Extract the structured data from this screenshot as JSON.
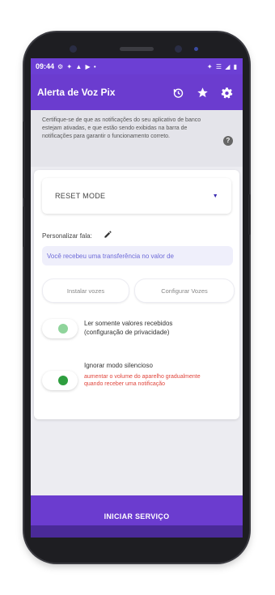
{
  "status_bar": {
    "time": "09:44",
    "left_icons": "⚙ ✦ ▲ ▶ •",
    "right_icons": "✦ ☰ ◢ ▮"
  },
  "app_bar": {
    "title": "Alerta de Voz Pix"
  },
  "notice": {
    "text": "Certifique-se de que as notificações do seu aplicativo de banco estejam ativadas, e que estão sendo exibidas na barra de notificações para garantir o funcionamento correto."
  },
  "mode_select": {
    "value": "RESET MODE"
  },
  "personalize": {
    "label": "Personalizar fala:"
  },
  "speech_input": {
    "value": "Você recebeu uma transferência no valor de"
  },
  "buttons": {
    "install_voices": "Instalar vozes",
    "configure_voices": "Configurar Vozes"
  },
  "toggles": [
    {
      "label": "Ler somente valores recebidos (configuração de privacidade)",
      "enabled": false
    },
    {
      "label": "Ignorar modo silencioso",
      "warning": "aumentar o volume do aparelho gradualmente quando receber uma notificação",
      "enabled": true
    }
  ],
  "cta": {
    "label": "INICIAR SERVIÇO"
  },
  "colors": {
    "primary": "#6b3ccf",
    "switch_off_knob": "#8fd49b",
    "switch_on_knob": "#2e9e3f",
    "warning": "#e0453c"
  },
  "icons": {
    "history": "history-icon",
    "star": "star-icon",
    "settings": "gear-icon",
    "help": "help-icon",
    "edit": "pencil-icon",
    "dropdown": "triangle-down-icon"
  }
}
